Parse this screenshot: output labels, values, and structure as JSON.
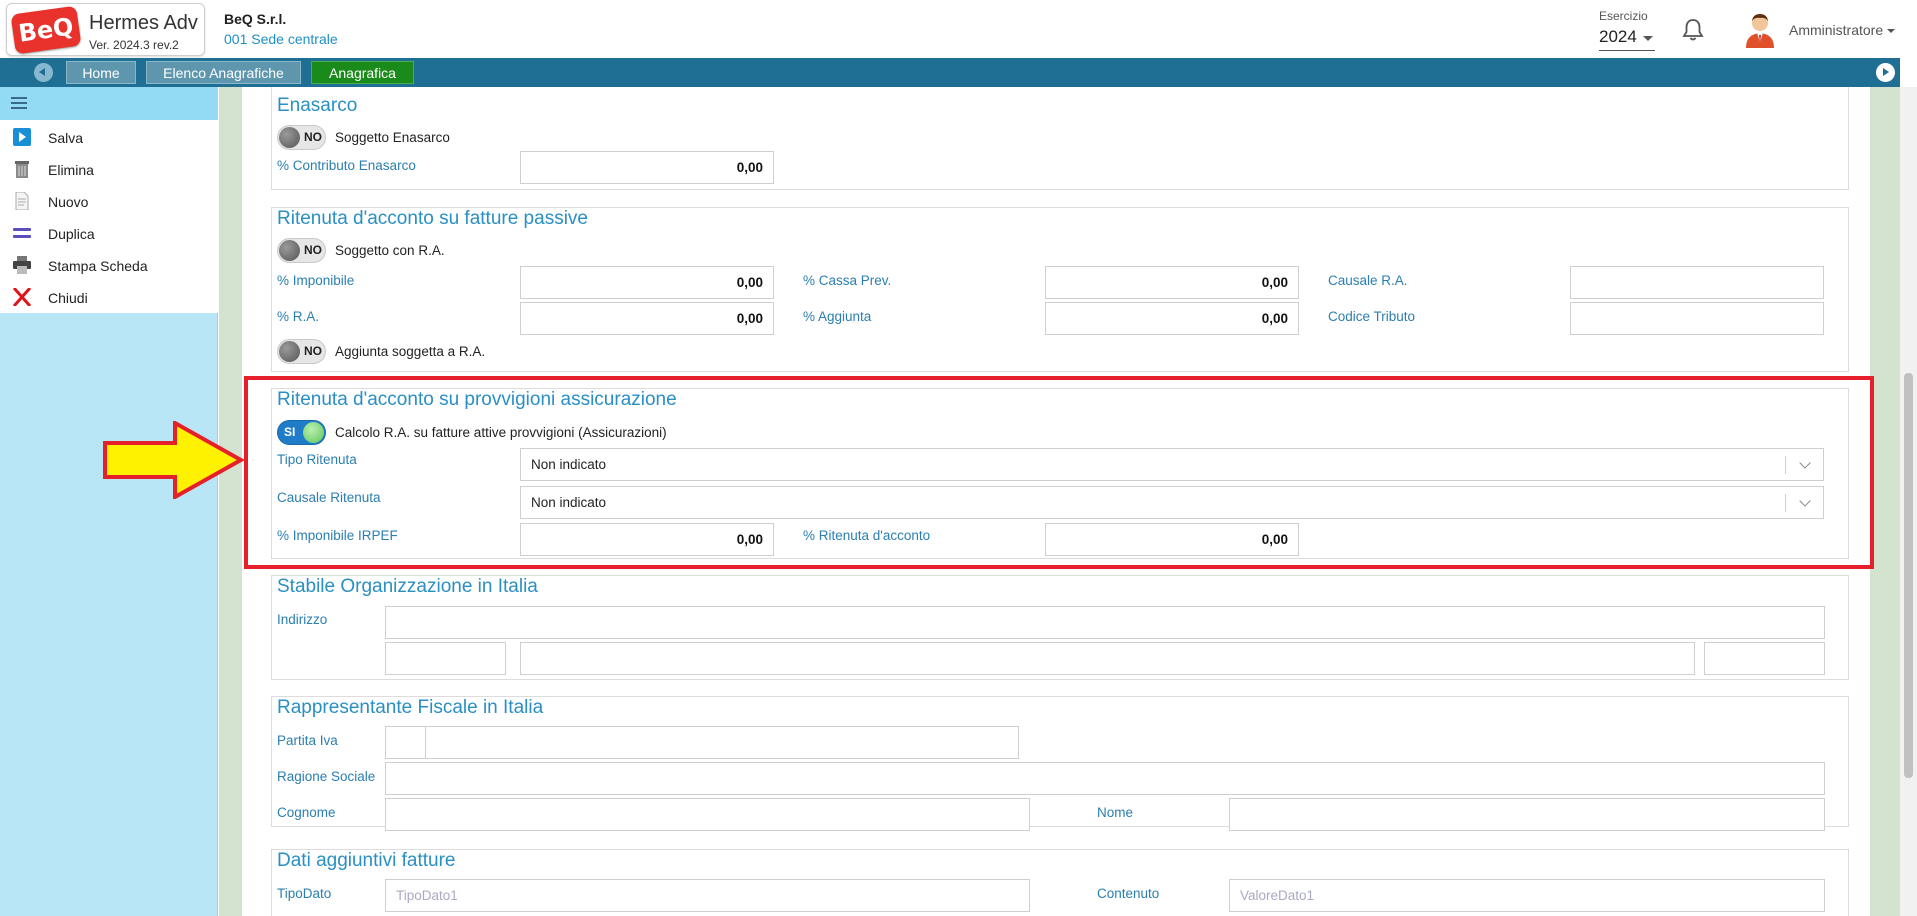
{
  "app": {
    "logo_text": "BeQ",
    "name": "Hermes Adv",
    "version": "Ver. 2024.3 rev.2",
    "company": "BeQ S.r.l.",
    "branch": "001 Sede centrale",
    "esercizio_label": "Esercizio",
    "esercizio_value": "2024",
    "user": "Amministratore"
  },
  "nav": {
    "tabs": [
      {
        "label": "Home"
      },
      {
        "label": "Elenco Anagrafiche"
      },
      {
        "label": "Anagrafica"
      }
    ]
  },
  "sidebar": {
    "items": [
      {
        "label": "Salva",
        "icon": "play-icon"
      },
      {
        "label": "Elimina",
        "icon": "trash-icon"
      },
      {
        "label": "Nuovo",
        "icon": "document-icon"
      },
      {
        "label": "Duplica",
        "icon": "equals-icon"
      },
      {
        "label": "Stampa Scheda",
        "icon": "printer-icon"
      },
      {
        "label": "Chiudi",
        "icon": "close-icon"
      }
    ]
  },
  "enasarco": {
    "title": "Enasarco",
    "toggle_label": "Soggetto Enasarco",
    "toggle_value": "NO",
    "contributo_label": "% Contributo Enasarco",
    "contributo_value": "0,00"
  },
  "ra_passive": {
    "title": "Ritenuta d'acconto su fatture passive",
    "toggle_label": "Soggetto con R.A.",
    "toggle_value": "NO",
    "imponibile_label": "% Imponibile",
    "imponibile_value": "0,00",
    "cassa_label": "% Cassa Prev.",
    "cassa_value": "0,00",
    "causale_label": "Causale R.A.",
    "ra_label": "% R.A.",
    "ra_value": "0,00",
    "aggiunta_label": "% Aggiunta",
    "aggiunta_value": "0,00",
    "codice_label": "Codice Tributo",
    "aggiunta_toggle_label": "Aggiunta soggetta a R.A.",
    "aggiunta_toggle_value": "NO"
  },
  "ra_provvigioni": {
    "title": "Ritenuta d'acconto su provvigioni assicurazione",
    "toggle_label": "Calcolo R.A. su fatture attive provvigioni (Assicurazioni)",
    "toggle_value": "SI",
    "tipo_label": "Tipo Ritenuta",
    "tipo_value": "Non indicato",
    "causale_label": "Causale Ritenuta",
    "causale_value": "Non indicato",
    "imponibile_label": "% Imponibile IRPEF",
    "imponibile_value": "0,00",
    "ritenuta_label": "% Ritenuta d'acconto",
    "ritenuta_value": "0,00"
  },
  "stabile": {
    "title": "Stabile Organizzazione in Italia",
    "indirizzo_label": "Indirizzo"
  },
  "rappresentante": {
    "title": "Rappresentante Fiscale in Italia",
    "partita_iva_label": "Partita Iva",
    "ragione_label": "Ragione Sociale",
    "cognome_label": "Cognome",
    "nome_label": "Nome"
  },
  "dati_aggiuntivi": {
    "title": "Dati aggiuntivi fatture",
    "tipodato_label": "TipoDato",
    "tipodato_placeholder": "TipoDato1",
    "contenuto_label": "Contenuto",
    "contenuto_placeholder": "ValoreDato1"
  },
  "colors": {
    "accent": "#2a8fc4",
    "navbar": "#1f6f94",
    "active_tab": "#1a8a1a",
    "highlight": "#e5202a",
    "arrow": "#fff200"
  }
}
